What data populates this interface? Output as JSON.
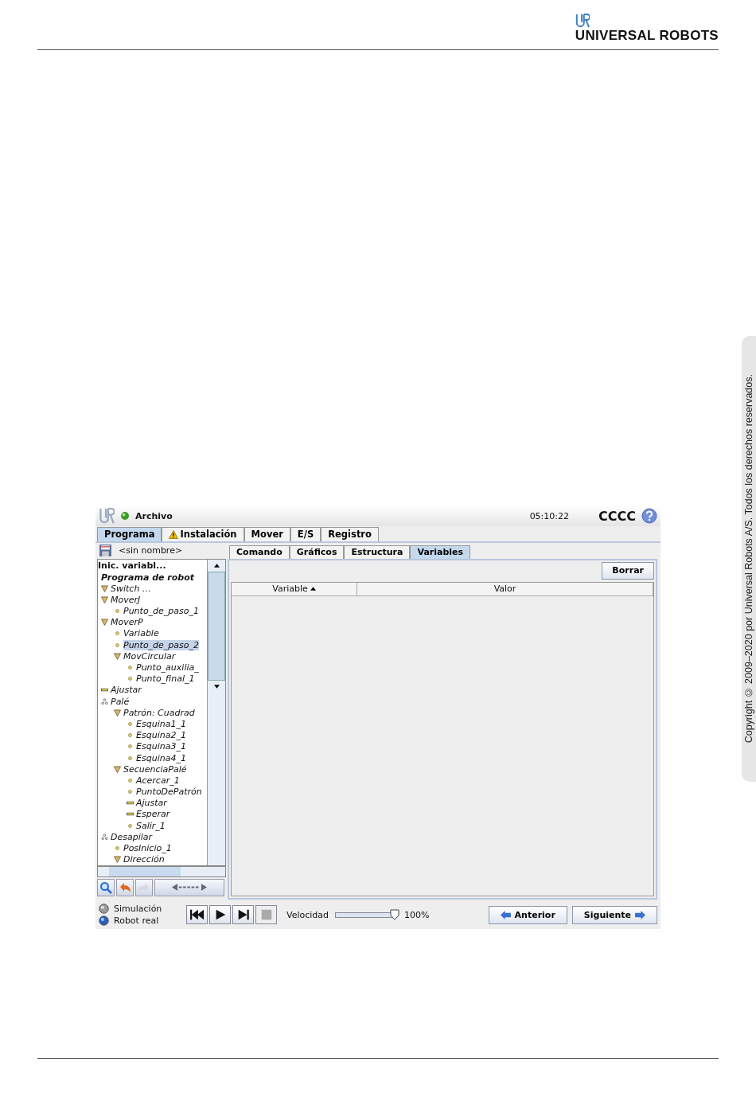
{
  "header": {
    "logo_text": "UNIVERSAL ROBOTS"
  },
  "side_note": "Copyright © 2009–2020 por Universal Robots A/S. Todos los derechos reservados.",
  "app": {
    "top_bar": {
      "menu": "Archivo",
      "time": "05:10:22",
      "robot_name": "CCCC"
    },
    "tabs": [
      {
        "label": "Programa",
        "selected": true,
        "warning": false
      },
      {
        "label": "Instalación",
        "selected": false,
        "warning": true
      },
      {
        "label": "Mover",
        "selected": false,
        "warning": false
      },
      {
        "label": "E/S",
        "selected": false,
        "warning": false
      },
      {
        "label": "Registro",
        "selected": false,
        "warning": false
      }
    ],
    "file_name": "<sin nombre>",
    "tree": [
      {
        "label": "Inic. variabl...",
        "kind": "init",
        "selected": false
      },
      {
        "label": "Programa de robot",
        "kind": "root",
        "selected": false
      },
      {
        "label": "Switch …",
        "kind": "folder",
        "selected": false
      },
      {
        "label": "MoverJ",
        "kind": "folder",
        "selected": false,
        "children": [
          {
            "label": "Punto_de_paso_1",
            "kind": "waypoint",
            "selected": false
          }
        ]
      },
      {
        "label": "MoverP",
        "kind": "folder",
        "selected": false,
        "children": [
          {
            "label": "Variable",
            "kind": "waypoint",
            "selected": false
          },
          {
            "label": "Punto_de_paso_2",
            "kind": "waypoint",
            "selected": true
          },
          {
            "label": "MovCircular",
            "kind": "folder",
            "selected": false,
            "children": [
              {
                "label": "Punto_auxilia_",
                "kind": "waypoint",
                "selected": false
              },
              {
                "label": "Punto_final_1",
                "kind": "waypoint",
                "selected": false
              }
            ]
          }
        ]
      },
      {
        "label": "Ajustar",
        "kind": "set",
        "selected": false
      },
      {
        "label": "Palé",
        "kind": "pallet",
        "selected": false,
        "children": [
          {
            "label": "Patrón: Cuadrad",
            "kind": "folder",
            "selected": false,
            "children": [
              {
                "label": "Esquina1_1",
                "kind": "waypoint",
                "selected": false
              },
              {
                "label": "Esquina2_1",
                "kind": "waypoint",
                "selected": false
              },
              {
                "label": "Esquina3_1",
                "kind": "waypoint",
                "selected": false
              },
              {
                "label": "Esquina4_1",
                "kind": "waypoint",
                "selected": false
              }
            ]
          },
          {
            "label": "SecuenciaPalé",
            "kind": "folder",
            "selected": false,
            "children": [
              {
                "label": "Acercar_1",
                "kind": "waypoint",
                "selected": false
              },
              {
                "label": "PuntoDePatrón",
                "kind": "waypoint",
                "selected": false
              },
              {
                "label": "Ajustar",
                "kind": "set",
                "selected": false
              },
              {
                "label": "Esperar",
                "kind": "set",
                "selected": false
              },
              {
                "label": "Salir_1",
                "kind": "waypoint",
                "selected": false
              }
            ]
          }
        ]
      },
      {
        "label": "Desapilar",
        "kind": "pallet",
        "selected": false,
        "children": [
          {
            "label": "PosInicio_1",
            "kind": "waypoint",
            "selected": false
          },
          {
            "label": "Dirección",
            "kind": "folder",
            "selected": false
          }
        ]
      }
    ],
    "tree_tools": [
      {
        "kind": "search",
        "disabled": false
      },
      {
        "kind": "undo",
        "disabled": false
      },
      {
        "kind": "redo",
        "disabled": true
      },
      {
        "kind": "move",
        "disabled": false
      }
    ],
    "sub_tabs": [
      {
        "label": "Comando",
        "selected": false
      },
      {
        "label": "Gráficos",
        "selected": false
      },
      {
        "label": "Estructura",
        "selected": false
      },
      {
        "label": "Variables",
        "selected": true
      }
    ],
    "clear_button": "Borrar",
    "table": {
      "columns": [
        {
          "label": "Variable",
          "sorted": true
        },
        {
          "label": "Valor",
          "sorted": false
        }
      ]
    },
    "modes": [
      {
        "label": "Simulación",
        "selected": false
      },
      {
        "label": "Robot real",
        "selected": true
      }
    ],
    "player": [
      {
        "kind": "rewind",
        "disabled": false
      },
      {
        "kind": "play",
        "disabled": false
      },
      {
        "kind": "step",
        "disabled": false
      },
      {
        "kind": "stop",
        "disabled": true
      }
    ],
    "speed": {
      "label": "Velocidad",
      "level": 1,
      "reading": "100%"
    },
    "nav": [
      {
        "label": "Anterior",
        "kind": "back"
      },
      {
        "label": "Siguiente",
        "kind": "next"
      }
    ]
  }
}
